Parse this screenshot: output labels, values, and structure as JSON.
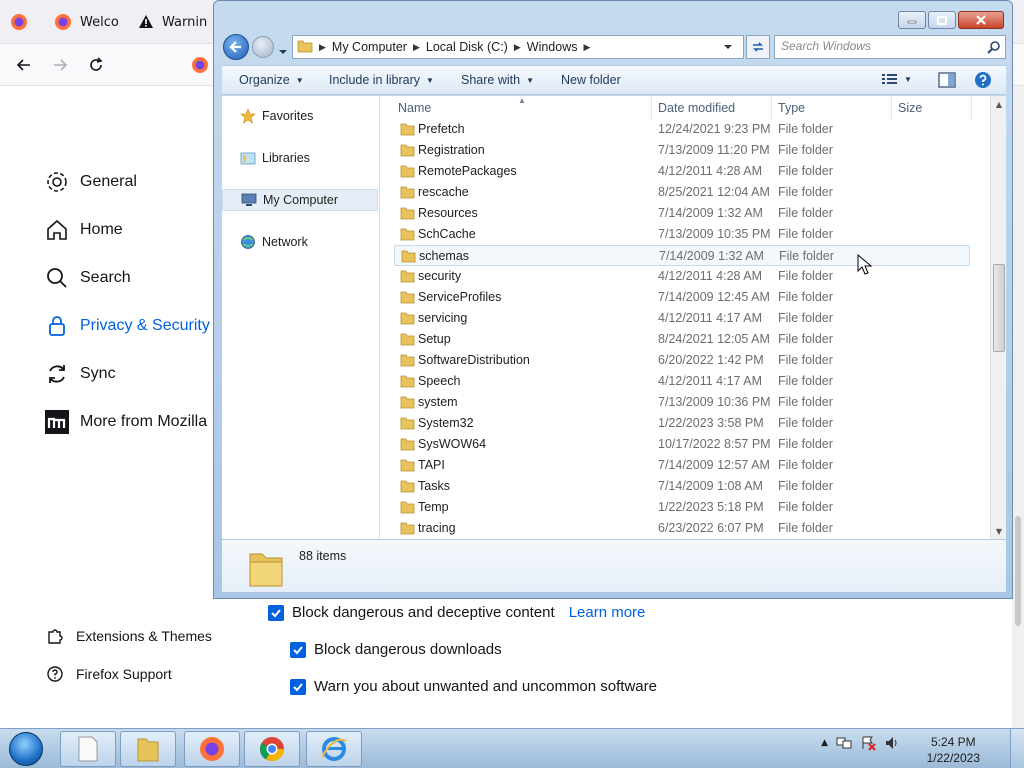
{
  "firefox": {
    "tabs": [
      {
        "label": ""
      },
      {
        "label": "Welco"
      },
      {
        "label": "Warnin"
      }
    ],
    "sidebar": [
      {
        "label": "General",
        "icon": "gear-icon"
      },
      {
        "label": "Home",
        "icon": "home-icon"
      },
      {
        "label": "Search",
        "icon": "search-icon"
      },
      {
        "label": "Privacy & Security",
        "icon": "lock-icon"
      },
      {
        "label": "Sync",
        "icon": "sync-icon"
      },
      {
        "label": "More from Mozilla",
        "icon": "mozilla-icon"
      }
    ],
    "footer_links": [
      {
        "label": "Extensions & Themes",
        "icon": "puzzle-icon"
      },
      {
        "label": "Firefox Support",
        "icon": "help-icon"
      }
    ],
    "checkboxes": [
      {
        "label": "Block dangerous and deceptive content",
        "link": "Learn more",
        "checked": true
      },
      {
        "label": "Block dangerous downloads",
        "checked": true
      },
      {
        "label": "Warn you about unwanted and uncommon software",
        "checked": true
      }
    ],
    "accent": "#0061e0"
  },
  "explorer": {
    "breadcrumb": [
      "My Computer",
      "Local Disk (C:)",
      "Windows"
    ],
    "search_placeholder": "Search Windows",
    "commands": {
      "organize": "Organize",
      "include": "Include in library",
      "share": "Share with",
      "new_folder": "New folder"
    },
    "nav": [
      {
        "label": "Favorites",
        "icon": "star-icon"
      },
      {
        "label": "Libraries",
        "icon": "library-icon"
      },
      {
        "label": "My Computer",
        "icon": "computer-icon",
        "selected": true
      },
      {
        "label": "Network",
        "icon": "network-icon"
      }
    ],
    "columns": {
      "name": "Name",
      "date": "Date modified",
      "type": "Type",
      "size": "Size"
    },
    "rows": [
      {
        "name": "Prefetch",
        "date": "12/24/2021 9:23 PM",
        "type": "File folder"
      },
      {
        "name": "Registration",
        "date": "7/13/2009 11:20 PM",
        "type": "File folder"
      },
      {
        "name": "RemotePackages",
        "date": "4/12/2011 4:28 AM",
        "type": "File folder"
      },
      {
        "name": "rescache",
        "date": "8/25/2021 12:04 AM",
        "type": "File folder"
      },
      {
        "name": "Resources",
        "date": "7/14/2009 1:32 AM",
        "type": "File folder"
      },
      {
        "name": "SchCache",
        "date": "7/13/2009 10:35 PM",
        "type": "File folder"
      },
      {
        "name": "schemas",
        "date": "7/14/2009 1:32 AM",
        "type": "File folder",
        "hover": true
      },
      {
        "name": "security",
        "date": "4/12/2011 4:28 AM",
        "type": "File folder"
      },
      {
        "name": "ServiceProfiles",
        "date": "7/14/2009 12:45 AM",
        "type": "File folder"
      },
      {
        "name": "servicing",
        "date": "4/12/2011 4:17 AM",
        "type": "File folder"
      },
      {
        "name": "Setup",
        "date": "8/24/2021 12:05 AM",
        "type": "File folder"
      },
      {
        "name": "SoftwareDistribution",
        "date": "6/20/2022 1:42 PM",
        "type": "File folder"
      },
      {
        "name": "Speech",
        "date": "4/12/2011 4:17 AM",
        "type": "File folder"
      },
      {
        "name": "system",
        "date": "7/13/2009 10:36 PM",
        "type": "File folder"
      },
      {
        "name": "System32",
        "date": "1/22/2023 3:58 PM",
        "type": "File folder"
      },
      {
        "name": "SysWOW64",
        "date": "10/17/2022 8:57 PM",
        "type": "File folder"
      },
      {
        "name": "TAPI",
        "date": "7/14/2009 12:57 AM",
        "type": "File folder"
      },
      {
        "name": "Tasks",
        "date": "7/14/2009 1:08 AM",
        "type": "File folder"
      },
      {
        "name": "Temp",
        "date": "1/22/2023 5:18 PM",
        "type": "File folder"
      },
      {
        "name": "tracing",
        "date": "6/23/2022 6:07 PM",
        "type": "File folder"
      }
    ],
    "item_count": "88 items",
    "folder_color": "#e8c25a"
  },
  "taskbar": {
    "time": "5:24 PM",
    "date": "1/22/2023"
  }
}
